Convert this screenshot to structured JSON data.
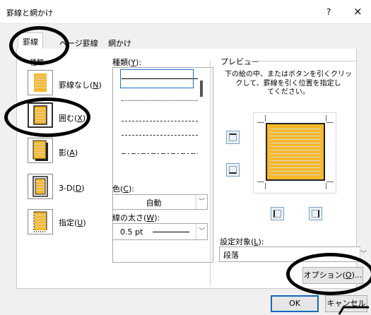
{
  "dialog": {
    "title": "罫線と網かけ",
    "help": "?",
    "close": "×"
  },
  "tabs": [
    {
      "label": "罫線",
      "active": true
    },
    {
      "label": "ページ罫線",
      "active": false
    },
    {
      "label": "網かけ",
      "active": false
    }
  ],
  "setting": {
    "header": "種類",
    "presets": [
      {
        "label": "罫線なし",
        "key": "N",
        "selected": false
      },
      {
        "label": "囲む",
        "key": "X",
        "selected": true
      },
      {
        "label": "影",
        "key": "A",
        "selected": false
      },
      {
        "label": "3-D",
        "key": "D",
        "selected": false
      },
      {
        "label": "指定",
        "key": "U",
        "selected": false
      }
    ]
  },
  "style": {
    "label": "種類",
    "key": "Y",
    "color_label": "色",
    "color_key": "C",
    "color_value": "自動",
    "width_label": "線の太さ",
    "width_key": "W",
    "width_value": "0.5 pt"
  },
  "preview": {
    "header": "プレビュー",
    "description_lines": [
      "下の絵の中、またはボタンを引くクリッ",
      "クして、罫線を引く位置を指定し",
      "てください。"
    ],
    "page_fill": "#f7b829",
    "apply_to_label": "設定対象",
    "apply_to_key": "L",
    "apply_to_value": "段落",
    "options_button": "オプション",
    "options_key": "O"
  },
  "footer": {
    "ok_button": "OK",
    "cancel_button": "キャンセル"
  },
  "colors": {
    "accent": "#0f6cbd",
    "annotation": "#000000"
  }
}
